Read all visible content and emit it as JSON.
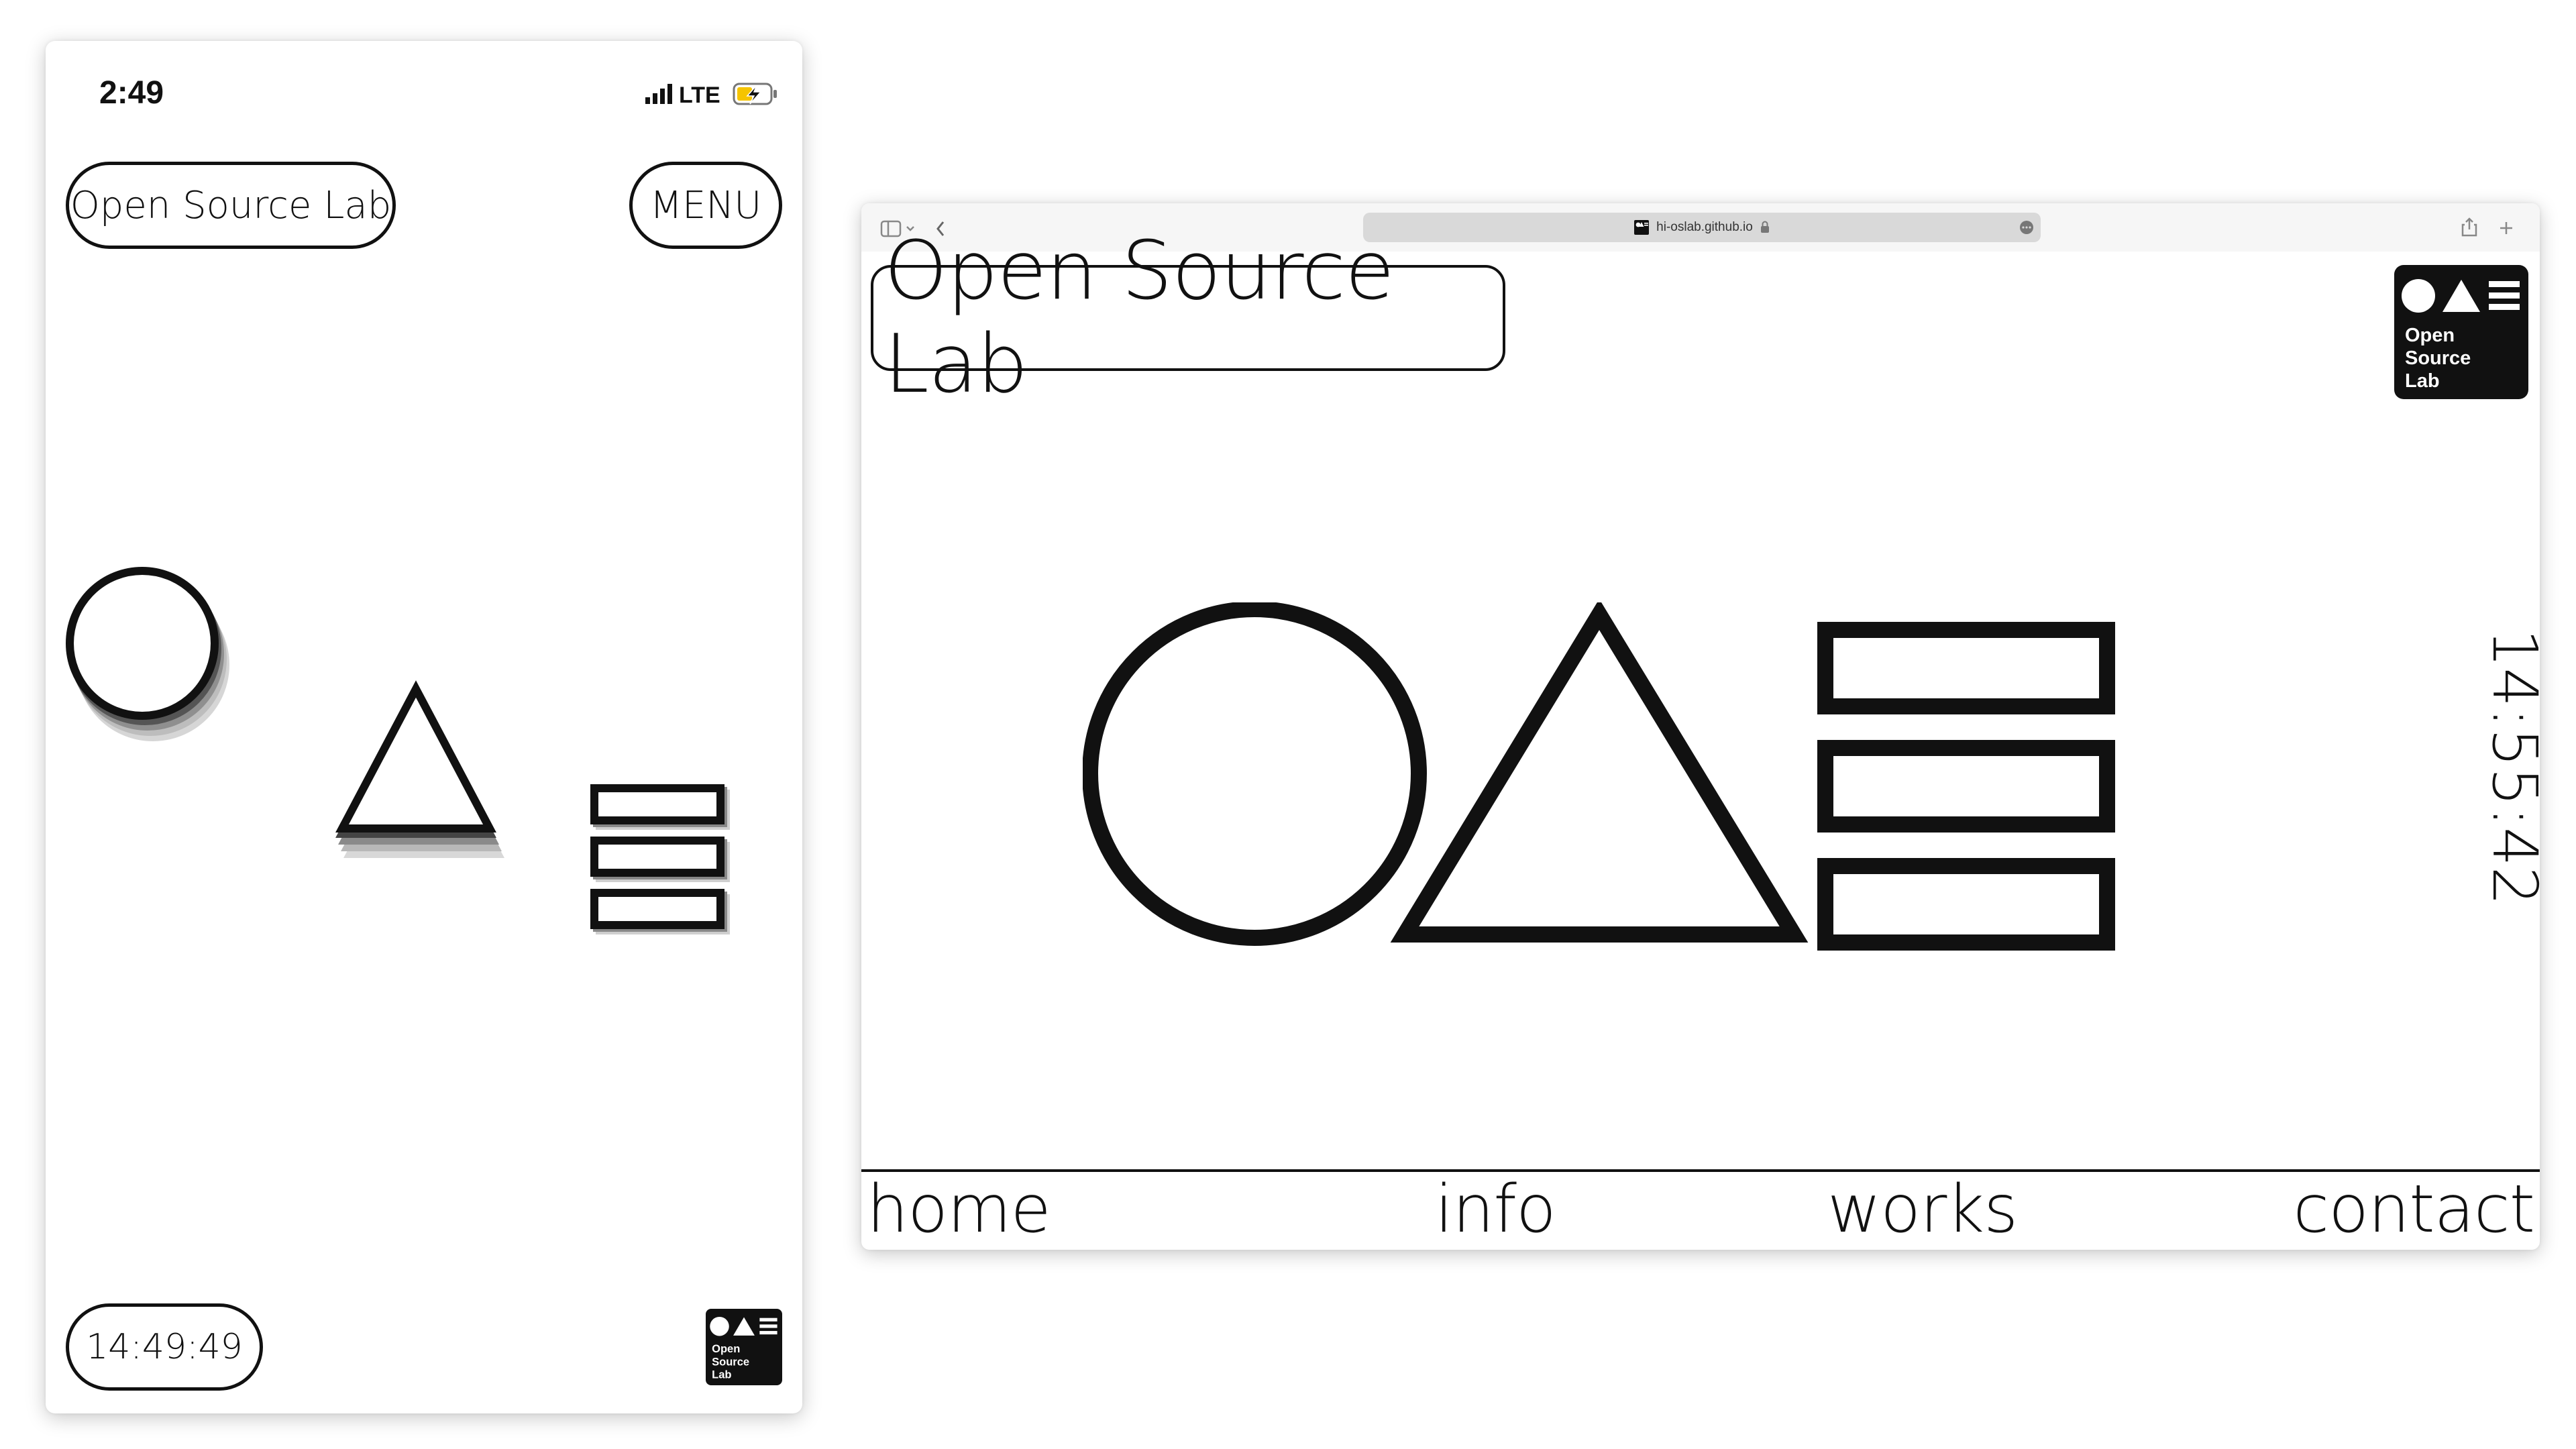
{
  "phone": {
    "status_time": "2:49",
    "network": "LTE",
    "title_label": "Open Source Lab",
    "menu_label": "MENU",
    "clock": "14:49:49",
    "logo_lines": [
      "Open",
      "Source",
      "Lab"
    ]
  },
  "browser": {
    "url": "hi-oslab.github.io",
    "site_title": "Open Source Lab",
    "logo_lines": [
      "Open",
      "Source",
      "Lab"
    ],
    "clock": "14:55:42",
    "nav": {
      "home": "home",
      "info": "info",
      "works": "works",
      "contact": "contact"
    }
  },
  "colors": {
    "ink": "#111111",
    "background": "#ffffff",
    "toolbar": "#f6f6f6",
    "address_bar": "#d9d9d9",
    "battery_charge": "#f5c400"
  },
  "icons": [
    "signal-bars-icon",
    "battery-charging-icon",
    "sidebar-icon",
    "chevron-down-icon",
    "back-chevron-icon",
    "site-favicon-icon",
    "lock-icon",
    "more-dots-icon",
    "share-icon",
    "new-tab-plus-icon",
    "circle-shape-icon",
    "triangle-shape-icon",
    "stacked-rectangles-icon"
  ]
}
